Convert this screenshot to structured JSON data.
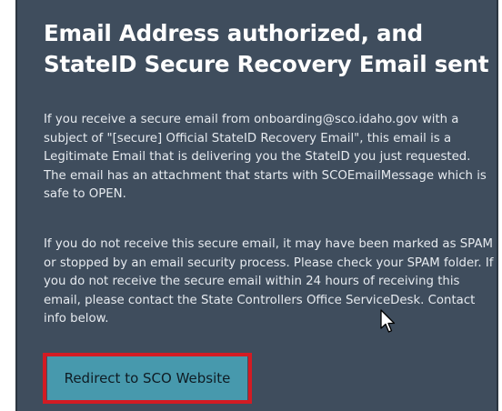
{
  "heading": {
    "title": "Email Address authorized, and StateID Secure Recovery Email sent"
  },
  "body": {
    "paragraph_1": "If you receive a secure email from onboarding@sco.idaho.gov with a subject of \"[secure] Official StateID Recovery Email\", this email is a Legitimate Email that is delivering you the StateID you just requested. The email has an attachment that starts with SCOEmailMessage which is safe to OPEN.",
    "paragraph_2": "If you do not receive this secure email, it may have been marked as SPAM or stopped by an email security process. Please check your SPAM folder. If you do not receive the secure email within 24 hours of receiving this email, please contact the State Controllers Office ServiceDesk. Contact info below."
  },
  "actions": {
    "redirect_label": "Redirect to SCO Website"
  },
  "colors": {
    "panel_background": "#3f4d5d",
    "button_background": "#4799ad",
    "highlight_outline": "#d31b23"
  },
  "icons": {
    "cursor": "mouse-pointer-icon"
  }
}
